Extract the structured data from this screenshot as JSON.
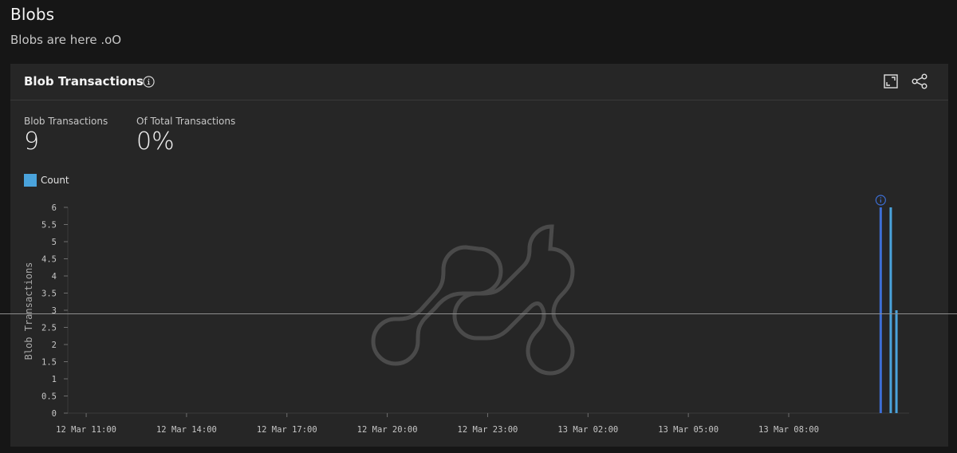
{
  "page": {
    "title": "Blobs",
    "subtitle": "Blobs are here .oO"
  },
  "panel": {
    "title": "Blob Transactions",
    "icons": {
      "info": "info-circle-icon",
      "expand": "maximize-icon",
      "share": "share-icon"
    },
    "kpis": [
      {
        "label": "Blob Transactions",
        "value": "9"
      },
      {
        "label": "Of Total Transactions",
        "value": "0%"
      }
    ],
    "legend": [
      {
        "label": "Count",
        "color": "#4aa3dc"
      }
    ]
  },
  "chart_data": {
    "type": "bar",
    "title": "Blob Transactions",
    "xlabel": "",
    "ylabel": "Blob Transactions",
    "ylim": [
      0,
      6
    ],
    "y_ticks": [
      "0",
      "0.5",
      "1",
      "1.5",
      "2",
      "2.5",
      "3",
      "3.5",
      "4",
      "4.5",
      "5",
      "5.5",
      "6"
    ],
    "y_tick_values": [
      0,
      0.5,
      1,
      1.5,
      2,
      2.5,
      3,
      3.5,
      4,
      4.5,
      5,
      5.5,
      6
    ],
    "x_ticks": [
      "12 Mar 11:00",
      "12 Mar 14:00",
      "12 Mar 17:00",
      "12 Mar 20:00",
      "12 Mar 23:00",
      "13 Mar 02:00",
      "13 Mar 05:00",
      "13 Mar 08:00"
    ],
    "x_tick_hours": [
      0,
      3,
      6,
      9,
      12,
      15,
      18,
      21
    ],
    "x_range_hours": [
      -0.55,
      24.6
    ],
    "grid": false,
    "legend_position": "top-left",
    "series": [
      {
        "name": "Count",
        "color": "#4aa3dc",
        "points": [
          {
            "x_hours": 23.75,
            "value": 6,
            "highlighted": true,
            "highlight_color": "#3d6fd6",
            "annotation": "info"
          },
          {
            "x_hours": 24.05,
            "value": 6
          },
          {
            "x_hours": 24.22,
            "value": 3
          }
        ]
      }
    ],
    "watermark": "logo"
  }
}
